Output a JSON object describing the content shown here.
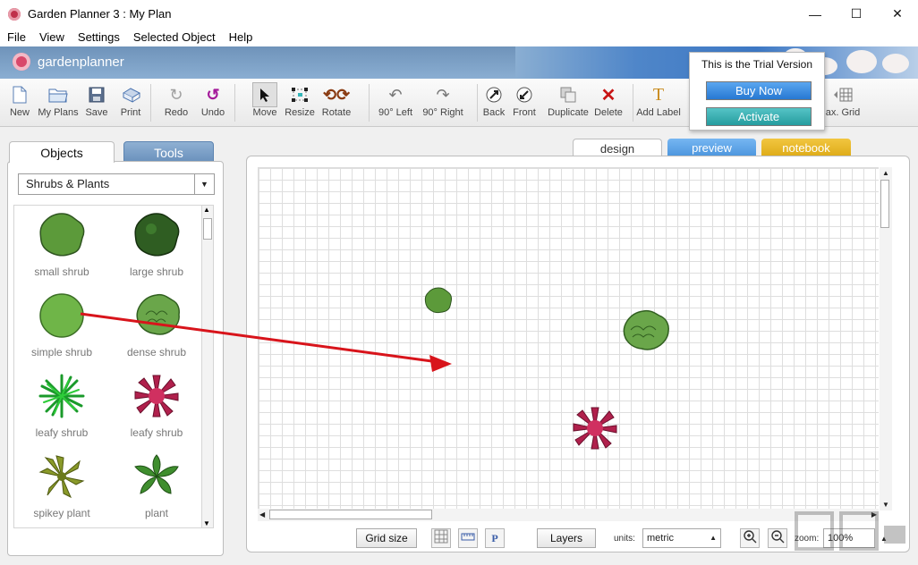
{
  "window": {
    "title": "Garden Planner 3 : My  Plan",
    "minimize": "—",
    "maximize": "☐",
    "close": "✕"
  },
  "menu": [
    "File",
    "View",
    "Settings",
    "Selected Object",
    "Help"
  ],
  "brand": {
    "name": "gardenplanner"
  },
  "toolbar": {
    "new": "New",
    "my_plans": "My Plans",
    "save": "Save",
    "print": "Print",
    "redo": "Redo",
    "undo": "Undo",
    "move": "Move",
    "resize": "Resize",
    "rotate": "Rotate",
    "rot_left": "90° Left",
    "rot_right": "90° Right",
    "back": "Back",
    "front": "Front",
    "duplicate": "Duplicate",
    "delete": "Delete",
    "add_label": "Add Label",
    "max_grid": "ax. Grid"
  },
  "trial": {
    "message": "This is the Trial Version",
    "buy": "Buy Now",
    "activate": "Activate"
  },
  "left_panel": {
    "tabs": [
      "Objects",
      "Tools"
    ],
    "category": "Shrubs & Plants",
    "items": [
      {
        "label": "small shrub",
        "color": "#5c9a3a"
      },
      {
        "label": "large shrub",
        "color": "#2f5d22"
      },
      {
        "label": "simple shrub",
        "color": "#6fb548"
      },
      {
        "label": "dense shrub",
        "color": "#6aa64a"
      },
      {
        "label": "leafy shrub",
        "color": "#2ecc3a"
      },
      {
        "label": "leafy shrub",
        "color": "#b0204c"
      },
      {
        "label": "spikey plant",
        "color": "#8a9a2a"
      },
      {
        "label": "plant",
        "color": "#3f8e2e"
      }
    ]
  },
  "view_tabs": [
    "design",
    "preview",
    "notebook"
  ],
  "bottom_bar": {
    "grid_size": "Grid size",
    "p_icon": "P",
    "layers": "Layers",
    "units_label": "units:",
    "units_value": "metric",
    "zoom_label": "zoom:",
    "zoom_value": "100%"
  },
  "colors": {
    "accent_blue": "#2778d2",
    "accent_teal": "#259c9f",
    "arrow_red": "#d8141b"
  }
}
